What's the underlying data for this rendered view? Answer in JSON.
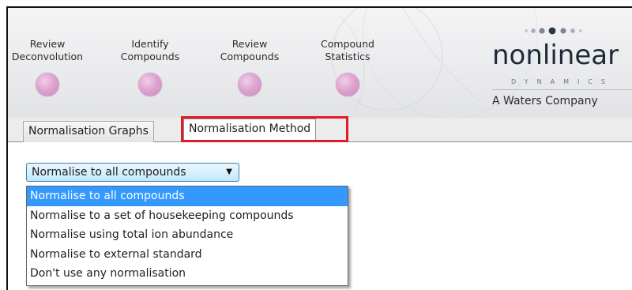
{
  "workflow": {
    "steps": [
      {
        "line1": "Review",
        "line2": "Deconvolution"
      },
      {
        "line1": "Identify",
        "line2": "Compounds"
      },
      {
        "line1": "Review",
        "line2": "Compounds"
      },
      {
        "line1": "Compound",
        "line2": "Statistics"
      }
    ],
    "step_circle_color": "#d9a2cd"
  },
  "brand": {
    "name": "nonlinear",
    "subtitle": "DYNAMICS",
    "company": "A Waters Company"
  },
  "tabs": [
    {
      "label": "Normalisation Graphs",
      "active": false
    },
    {
      "label": "Normalisation Method",
      "active": true
    }
  ],
  "highlight_color": "#e01b24",
  "normalisation": {
    "selected": "Normalise to all compounds",
    "options": [
      "Normalise to all compounds",
      "Normalise to a set of housekeeping compounds",
      "Normalise using total ion abundance",
      "Normalise to external standard",
      "Don't use any normalisation"
    ],
    "selected_color": "#3399ff"
  }
}
